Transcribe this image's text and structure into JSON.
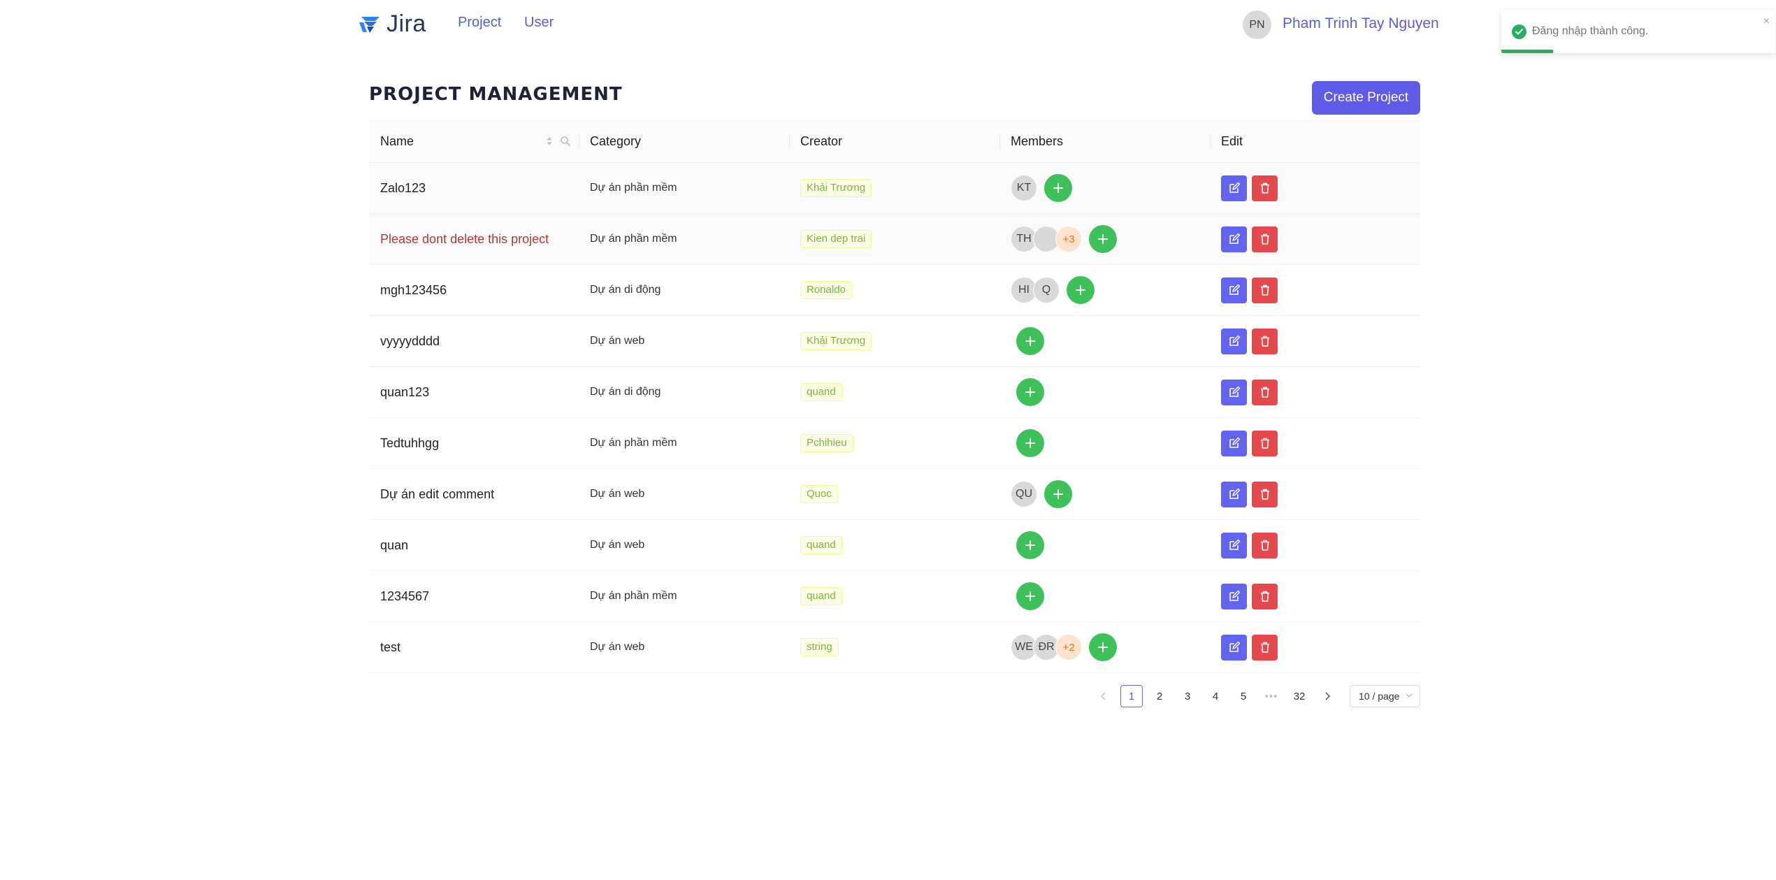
{
  "header": {
    "logo_text": "Jira",
    "nav": [
      {
        "label": "Project"
      },
      {
        "label": "User"
      }
    ],
    "user": {
      "initials": "PN",
      "name": "Pham Trinh Tay Nguyen"
    }
  },
  "toast": {
    "message": "Đăng nhập thành công.",
    "close": "×",
    "progress_fraction": 0.19
  },
  "page": {
    "title": "PROJECT MANAGEMENT",
    "create_button": "Create Project"
  },
  "table": {
    "columns": [
      "Name",
      "Category",
      "Creator",
      "Members",
      "Edit"
    ],
    "rows": [
      {
        "name": "Zalo123",
        "category": "Dự án phần mềm",
        "creator": "Khải Trương",
        "members": [
          "KT"
        ],
        "more": ""
      },
      {
        "name": "Please dont delete this project",
        "category": "Dự án phần mềm",
        "creator": "Kien dep trai",
        "members": [
          "TH",
          ""
        ],
        "more": "+3"
      },
      {
        "name": "mgh123456",
        "category": "Dự án di động",
        "creator": "Ronaldo",
        "members": [
          "HI",
          "Q"
        ],
        "more": ""
      },
      {
        "name": "vyyyydddd",
        "category": "Dự án web",
        "creator": "Khải Trương",
        "members": [],
        "more": ""
      },
      {
        "name": "quan123",
        "category": "Dự án di động",
        "creator": "quand",
        "members": [],
        "more": ""
      },
      {
        "name": "Tedtuhhgg",
        "category": "Dự án phần mềm",
        "creator": "Pchihieu",
        "members": [],
        "more": ""
      },
      {
        "name": "Dự án edit comment",
        "category": "Dự án web",
        "creator": "Quoc",
        "members": [
          "QU"
        ],
        "more": ""
      },
      {
        "name": "quan",
        "category": "Dự án web",
        "creator": "quand",
        "members": [],
        "more": ""
      },
      {
        "name": "1234567",
        "category": "Dự án phần mềm",
        "creator": "quand",
        "members": [],
        "more": ""
      },
      {
        "name": "test",
        "category": "Dự án web",
        "creator": "string",
        "members": [
          "WE",
          "ĐR"
        ],
        "more": "+2"
      }
    ]
  },
  "pagination": {
    "pages": [
      "1",
      "2",
      "3",
      "4",
      "5",
      "•••",
      "32"
    ],
    "current": "1",
    "page_size": "10 / page"
  },
  "colors": {
    "accent": "#5e5ce6",
    "add": "#3ec15a",
    "edit": "#6164f0",
    "delete": "#e5484d",
    "success": "#27ae60"
  }
}
